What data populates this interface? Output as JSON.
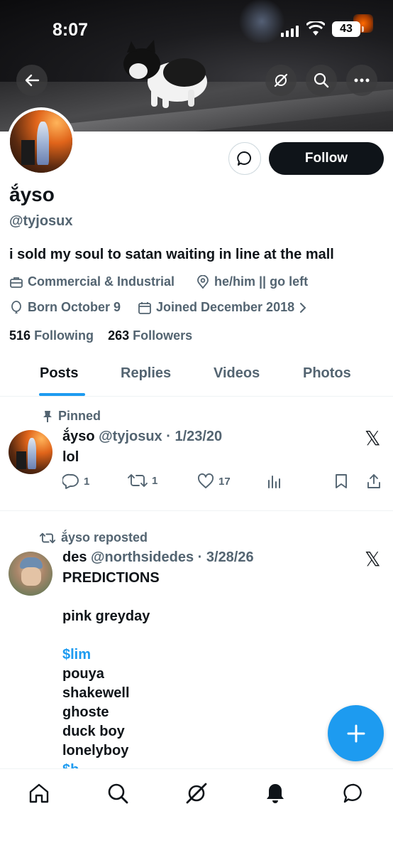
{
  "status_bar": {
    "time": "8:07",
    "battery": "43"
  },
  "profile": {
    "display_name": "ắyso",
    "handle": "@tyjosux",
    "bio": "i sold my soul to satan waiting in line at the mall",
    "category": "Commercial & Industrial",
    "location": "he/him || go left",
    "birthday": "Born October 9",
    "joined": "Joined December 2018",
    "following_count": "516",
    "following_label": "Following",
    "followers_count": "263",
    "followers_label": "Followers",
    "follow_button": "Follow"
  },
  "tabs": [
    "Posts",
    "Replies",
    "Videos",
    "Photos"
  ],
  "posts": [
    {
      "context": "Pinned",
      "name": "ắyso",
      "handle_date": "@tyjosux · 1/23/20",
      "text": "lol",
      "replies": "1",
      "reposts": "1",
      "likes": "17"
    },
    {
      "context": "ắyso reposted",
      "name": "des",
      "handle_date": "@northsidedes · 3/28/26",
      "lines": [
        "PREDICTIONS",
        "",
        "pink greyday",
        "",
        "$lim",
        "pouya",
        "shakewell",
        "ghoste",
        "duck boy",
        "lonelyboy",
        "$b"
      ]
    }
  ],
  "icons": {
    "x_logo": "𝕏",
    "fab": "plus-icon"
  },
  "colors": {
    "accent": "#1d9bf0",
    "text": "#0f1419",
    "muted": "#536471"
  }
}
